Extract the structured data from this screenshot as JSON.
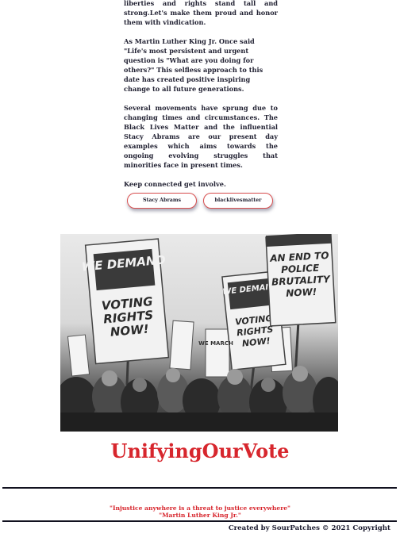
{
  "article": {
    "para1": "liberties and rights stand tall and strong.Let's make them proud and honor them with vindication.",
    "para2": "As Martin Luther King Jr. Once said \"Life's most persistent and urgent question is \"What are you doing for others?\" This selfless approach to this date has created positive inspiring change to all future generations.",
    "para3": "Several movements have sprung due to changing times and circumstances. The Black Lives Matter and the influential Stacy Abrams are our present day examples which aims towards the ongoing evolving struggles that minorities face in present times.",
    "para4": "Keep connected get involve."
  },
  "tags": [
    "Stacy Abrams",
    "blacklivesmatter"
  ],
  "photo": {
    "signs": [
      "WE DEMAND",
      "VOTING RIGHTS NOW!",
      "WE MARCH",
      "WE DEMAND",
      "VOTING RIGHTS NOW!",
      "AN END TO POLICE BRUTALITY NOW!",
      "DEMAND"
    ]
  },
  "brand": "UnifyingOurVote",
  "footer": {
    "quote": "\"Injustice anywhere is a threat to justice everywhere\"",
    "attribution": "\"Martin Luther King Jr.\"",
    "copyright": "Created by SourPatches © 2021 Copyright"
  }
}
